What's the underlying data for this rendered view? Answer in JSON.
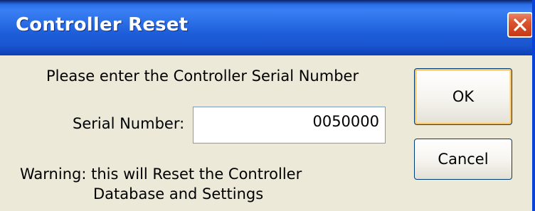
{
  "window": {
    "title": "Controller Reset"
  },
  "icons": {
    "close": "close-icon"
  },
  "colors": {
    "titlebar": "#1d5cd8",
    "close_button": "#d9542e",
    "dialog_background": "#ece9d8",
    "default_button_highlight": "#f4c260"
  },
  "form": {
    "prompt": "Please enter the Controller Serial Number",
    "serial_label": "Serial Number:",
    "serial_value": "0050000",
    "warning_line1": "Warning: this will Reset the Controller",
    "warning_line2": "Database and Settings"
  },
  "buttons": {
    "ok_label": "OK",
    "cancel_label": "Cancel"
  }
}
